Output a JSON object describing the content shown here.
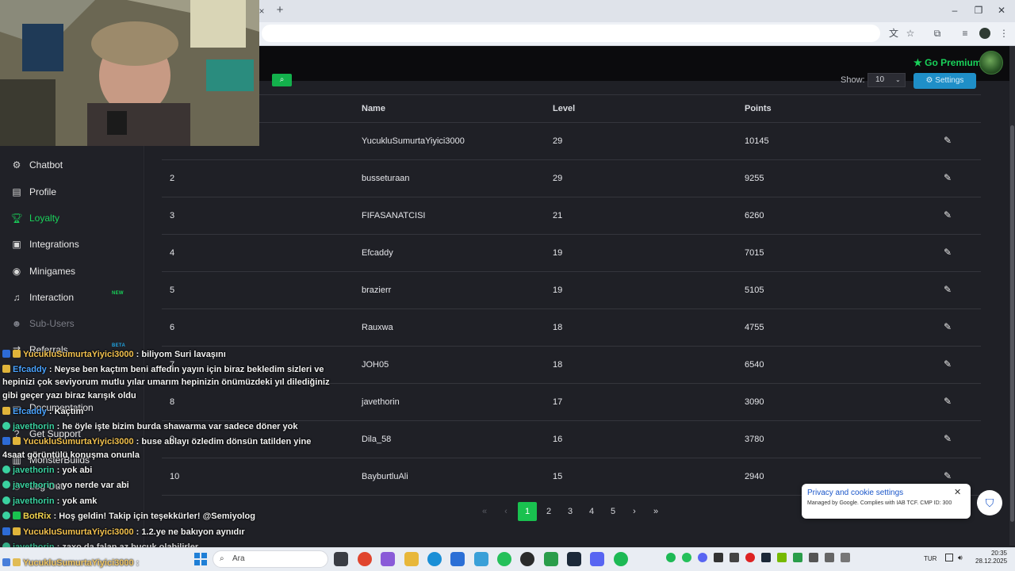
{
  "browser": {
    "new_tab_symbol": "+",
    "close_tab_symbol": "×"
  },
  "header": {
    "premium_label": "Go Premium"
  },
  "sidebar": {
    "items": [
      {
        "label": "Chatbot",
        "icon": "robot-icon"
      },
      {
        "label": "Profile",
        "icon": "id-card-icon"
      },
      {
        "label": "Loyalty",
        "icon": "trophy-icon",
        "active": true
      },
      {
        "label": "Integrations",
        "icon": "integrations-icon"
      },
      {
        "label": "Minigames",
        "icon": "gamepad-icon"
      },
      {
        "label": "Interaction",
        "icon": "music-icon",
        "badge": "NEW"
      },
      {
        "label": "Sub-Users",
        "icon": "users-icon"
      },
      {
        "label": "Referrals",
        "icon": "referrals-icon",
        "badge": "BETA"
      },
      {
        "label": "Documentation",
        "icon": "book-icon"
      },
      {
        "label": "Get Support",
        "icon": "question-icon"
      },
      {
        "label": "MonsterBuilds",
        "icon": "monster-icon"
      },
      {
        "label": "Log Out",
        "icon": "power-icon"
      }
    ]
  },
  "toolbar": {
    "show_label": "Show:",
    "show_value": "10",
    "settings_label": "Settings"
  },
  "table": {
    "columns": [
      "Name",
      "Level",
      "Points"
    ],
    "rows": [
      {
        "rank": "1",
        "name": "YucukluSumurtaYiyici3000",
        "level": "29",
        "points": "10145"
      },
      {
        "rank": "2",
        "name": "busseturaan",
        "level": "29",
        "points": "9255"
      },
      {
        "rank": "3",
        "name": "FIFASANATCISI",
        "level": "21",
        "points": "6260"
      },
      {
        "rank": "4",
        "name": "Efcaddy",
        "level": "19",
        "points": "7015"
      },
      {
        "rank": "5",
        "name": "brazierr",
        "level": "19",
        "points": "5105"
      },
      {
        "rank": "6",
        "name": "Rauxwa",
        "level": "18",
        "points": "4755"
      },
      {
        "rank": "7",
        "name": "JOH05",
        "level": "18",
        "points": "6540"
      },
      {
        "rank": "8",
        "name": "javethorin",
        "level": "17",
        "points": "3090"
      },
      {
        "rank": "9",
        "name": "Dila_58",
        "level": "16",
        "points": "3780"
      },
      {
        "rank": "10",
        "name": "BayburtluAli",
        "level": "15",
        "points": "2940"
      }
    ]
  },
  "pagination": {
    "first": "«",
    "prev": "‹",
    "pages": [
      "1",
      "2",
      "3",
      "4",
      "5"
    ],
    "current": "1",
    "next": "›",
    "last": "»"
  },
  "cookie": {
    "title": "Privacy and cookie settings",
    "subtitle": "Managed by Google. Complies with IAB TCF. CMP ID: 300"
  },
  "chat": [
    {
      "user": "YucukluSumurtaYiyici3000",
      "user_color": "#f2c14e",
      "text": "biliyom Suri lavaşını"
    },
    {
      "user": "Efcaddy",
      "user_color": "#4aa3ff",
      "text": "Neyse ben kaçtım beni affedin yayın için biraz bekledim sizleri ve"
    },
    {
      "user": "",
      "user_color": "#ffffff",
      "text": "hepinizi çok seviyorum mutlu yılar umarım hepinizin önümüzdeki yıl dilediğiniz"
    },
    {
      "user": "",
      "user_color": "#ffffff",
      "text": "gibi geçer yazı biraz karışık oldu"
    },
    {
      "user": "Efcaddy",
      "user_color": "#4aa3ff",
      "text": "Kaçtım"
    },
    {
      "user": "javethorin",
      "user_color": "#3ad1a0",
      "text": "he öyle işte bizim burda shawarma var sadece döner yok"
    },
    {
      "user": "YucukluSumurtaYiyici3000",
      "user_color": "#f2c14e",
      "text": "buse ablayı özledim dönsün tatilden yine"
    },
    {
      "user": "",
      "user_color": "#ffffff",
      "text": "4saat görüntülü konuşma onunla"
    },
    {
      "user": "javethorin",
      "user_color": "#3ad1a0",
      "text": "yok abi"
    },
    {
      "user": "javethorin",
      "user_color": "#3ad1a0",
      "text": "yo nerde var abi"
    },
    {
      "user": "javethorin",
      "user_color": "#3ad1a0",
      "text": "yok amk"
    },
    {
      "user": "BotRix",
      "user_color": "#f2d34e",
      "text": "Hoş geldin! Takip için teşekkürler! @Semiyolog"
    },
    {
      "user": "YucukluSumurtaYiyici3000",
      "user_color": "#f2c14e",
      "text": "1.2.ye ne bakıyon aynıdır"
    },
    {
      "user": "javethorin",
      "user_color": "#3ad1a0",
      "text": "zaxo da falan az buçuk olabilirler"
    },
    {
      "user": "YucukluSumurtaYiyici3000",
      "user_color": "#f2c14e",
      "text": ""
    }
  ],
  "taskbar": {
    "search_placeholder": "Ara",
    "language": "TUR",
    "time": "20:35",
    "date": "28.12.2025"
  },
  "colors": {
    "accent": "#19d25a",
    "settings_button": "#1f8fc8",
    "background": "#1f2026",
    "sidebar": "#202127"
  }
}
